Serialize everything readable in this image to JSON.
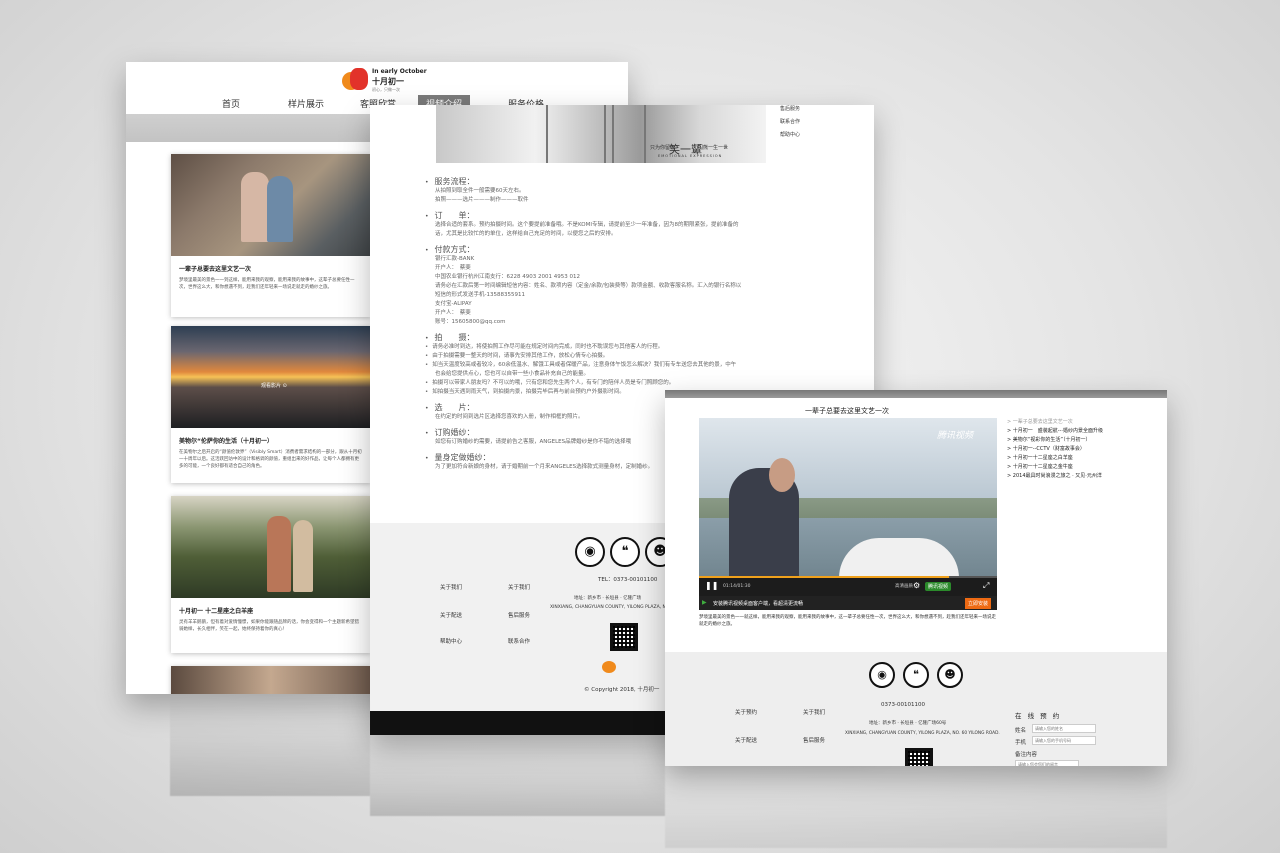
{
  "page_a": {
    "logo": {
      "en": "In early October",
      "cn": "十月初一",
      "tagline": "初心，只做一次"
    },
    "nav": [
      "首页",
      "样片展示",
      "客照欣赏",
      "视频介绍",
      "服务价格"
    ],
    "active_nav_index": 3,
    "cards": [
      {
        "title": "一辈子总要去这里文艺一次",
        "text": "梦境里最美的景色一一到这样，能用来我的观察，能用来我的故事中，这辈子总要任性一次，世界这么大，和你想遇不到，趁我们还年轻来一场说走就走的婚纱之旅。"
      },
      {
        "title": "美物尔“伦萨你的生活（十月初一）",
        "text": "在美物尔之后开启的“颜值伦敦界”（Visibly Smart）消费者需求结构的一部分，跟从十月初一十周年以后。这活跃回访中的设计和格调的颜值，重组出来的好作品，让每个人都拥有更多的可能，一个良好都有适合自己的角色。",
        "badge": "观看影片 ⊙"
      },
      {
        "title": "十月初一 十二星座之白羊座",
        "text": "灵有羊羊鹅鹅，但有着对爱情憧憬，如果你能跟随品牌的话，你会变得和一个主题新希望猎骑她样，长久相伴，笑在一起，始终保持着你的真心！"
      },
      {
        "title": "",
        "text": ""
      }
    ]
  },
  "page_b": {
    "banner": {
      "cap_left": "只为你留存",
      "cap_main": "笑一颦",
      "cap_right": "闪熊一生一世",
      "cap_sub": "EMOTIONAL EXPRESSION"
    },
    "right_links": [
      "售后服务",
      "联系合作",
      "帮助中心"
    ],
    "sections": [
      {
        "title": "服务流程：",
        "lines": [
          "从拍照到取全件一般需要60天左右。",
          "拍照———选片———制作———取件"
        ]
      },
      {
        "title": "订　　单：",
        "lines": [
          "选择合适的套系。预约拍摄时间。这个要提前准备哦。不是KOMI专辑，请提前至少一年准备，因为8的期限紧张，提前准备的",
          "话，尤其是比较忙的的单位，这样给自己充足的时间，以便您之后的安排。"
        ]
      },
      {
        "title": "付款方式：",
        "lines": [
          "银行汇款-BANK",
          "开户人：　蔡斐",
          "中国农业银行杭州江南支行：6228 4903 2001 4953 012",
          "请务必在汇款后第一时间编辑短信内容：姓名、款项内容（定金/余款/包装费等）款项金额、收款客服名称。汇入的银行名称以",
          "短信的形式发送手机-13588355911",
          "支付宝-ALIPAY",
          "开户人：　蔡斐",
          "账号：15605800@qq.com"
        ]
      }
    ],
    "shoot_title": "拍　　摄：",
    "shoot_bullets": [
      "请务必准时到达，将使拍照工作尽可能在规定时间内完成，同时也不耽误您与其他客人的行程。",
      "由于拍摄需要一整天的时间，请事先安排其他工作，放松心情专心拍摄。",
      "如当天温度较高或者较冷，60余低温水、解饿工具或者保暖产品，注意身体午饭怎么解决？我们有专车送您去其他的景，中午",
      "也会给您提供点心，您也可以自带一些小食品补充自己的能量。",
      "拍摄可以带家人朋友吗？不可以的哦，只有您和您先生两个人，有专门的陪伴人员是专门照顾您的。",
      "如拍摄当天遇到雨天气，到拍摄内景，拍摄完毕后再与前台预约户外摄影时间。"
    ],
    "sections2": [
      {
        "title": "选　　片：",
        "lines": [
          "在约定的时间到选片区选择您喜欢的入册，制作相框的照片。"
        ]
      },
      {
        "title": "订购婚纱：",
        "lines": [
          "如您有订购婚纱的需要，请提前告之客服，ANGELES品牌婚纱是你不错的选择哦"
        ]
      },
      {
        "title": "量身定做婚纱：",
        "lines": [
          "为了更加符合新娘的身材，请于婚期前一个月来ANGELES选择款式测量身材，定制婚纱。"
        ]
      }
    ],
    "footer": {
      "tel": "TEL：0373-00101100",
      "links": [
        "关于我们",
        "关于我们",
        "关于配送",
        "售后服务",
        "帮助中心",
        "联系合作"
      ],
      "address": "XINXIANG, CHANGYUAN COUNTY, YILONG PLAZA, NO.",
      "address_cn": "地址：新乡市 · 长垣县 · 亿隆广场",
      "copyright": "© Copyright 2018, 十月初一"
    }
  },
  "page_c": {
    "video_title": "一辈子总要去这里文艺一次",
    "brand": "腾讯视频",
    "time": "01:14/01:30",
    "defn": "高清画质",
    "hd_label": "腾讯视频",
    "ad_text": "安装腾讯视频桌面客户端，看超清更流畅",
    "ad_button": "立即安装",
    "progress": 0.84,
    "sidelist": [
      "一辈子总要去这里文艺一次",
      "十月初一　盛装起航--·婚纱内景全面升级",
      "美物尔“视彩你的生活”（十月初一）",
      "十月初一--CCTV（财富故事会）",
      "十月初一十二星座之白羊座",
      "十月初一十二星座之金牛座",
      "2014最具时尚浪漫之旅之 · 又见·元州洋"
    ],
    "desc": "梦境里最美的景色一一就这样，能用来我的观察，能用来我的故事中，这一辈子总要任性一次，世界这么大，和你想遇不到，趁我们还年轻来一场说走就走的婚纱之旅。",
    "footer": {
      "tel": "0373-00101100",
      "links": [
        "关于预约",
        "关于我们",
        "关于配送",
        "售后服务"
      ],
      "address_cn": "地址：新乡市 · 长垣县 · 亿隆广场60号",
      "address": "XINXIANG, CHANGYUAN COUNTY, YILONG PLAZA, NO. 60 YILONG ROAD."
    },
    "form": {
      "heading": "在 线 预 约",
      "rows": [
        {
          "label": "姓名",
          "placeholder": "请输入您的姓名"
        },
        {
          "label": "手机",
          "placeholder": "请输入您的手机号码"
        },
        {
          "label": "备注内容",
          "placeholder": ""
        },
        {
          "label": "",
          "placeholder": "请输入您会您们的留言"
        }
      ]
    }
  }
}
